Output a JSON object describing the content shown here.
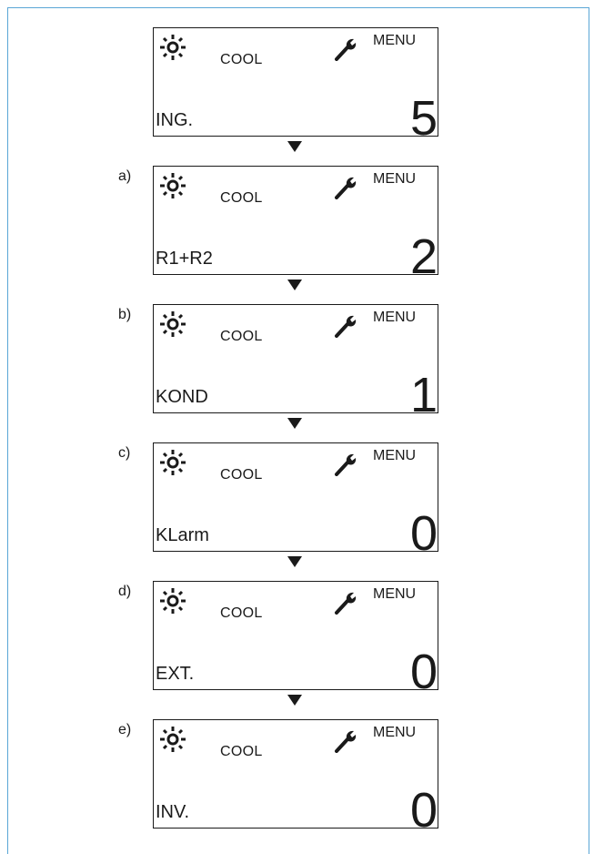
{
  "screens": [
    {
      "step": "",
      "mode": "COOL",
      "menu": "MENU",
      "code": "ING.",
      "value": "5"
    },
    {
      "step": "a)",
      "mode": "COOL",
      "menu": "MENU",
      "code": "R1+R2",
      "value": "2"
    },
    {
      "step": "b)",
      "mode": "COOL",
      "menu": "MENU",
      "code": "KOND",
      "value": "1"
    },
    {
      "step": "c)",
      "mode": "COOL",
      "menu": "MENU",
      "code": "KLarm",
      "value": "0"
    },
    {
      "step": "d)",
      "mode": "COOL",
      "menu": "MENU",
      "code": "EXT.",
      "value": "0"
    },
    {
      "step": "e)",
      "mode": "COOL",
      "menu": "MENU",
      "code": "INV.",
      "value": "0"
    }
  ],
  "icons": {
    "mode_icon": "sun-icon",
    "menu_icon": "wrench-icon",
    "transition": "arrow-down-icon"
  },
  "colors": {
    "frame": "#5aa6d6",
    "ink": "#1a1a1a"
  }
}
